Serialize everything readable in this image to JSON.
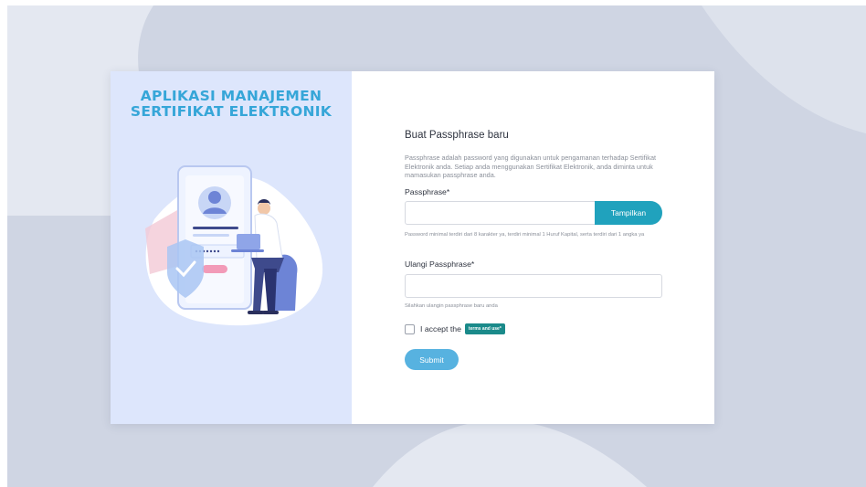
{
  "app": {
    "title_line1": "APLIKASI MANAJEMEN",
    "title_line2": "SERTIFIKAT ELEKTRONIK"
  },
  "form": {
    "heading": "Buat Passphrase baru",
    "description": "Passphrase adalah password yang digunakan untuk pengamanan terhadap Sertifikat Elektronik anda. Setiap anda menggunakan Sertifikat Elektronik, anda diminta untuk mamasukan passphrase anda.",
    "passphrase_label": "Passphrase*",
    "passphrase_value": "",
    "show_button_label": "Tampilkan",
    "passphrase_hint": "Password minimal terdiri dari 8 karakter ya, terdiri minimal 1 Huruf Kapital, serta terdiri dari 1 angka ya",
    "repeat_label": "Ulangi Passphrase*",
    "repeat_value": "",
    "repeat_hint": "Silahkan ulangin passphrase baru anda",
    "accept_text": "I accept the",
    "terms_label": "terms and use*",
    "submit_label": "Submit"
  },
  "colors": {
    "accent": "#20a2bd",
    "submit": "#57b2e0",
    "title": "#36a6d8",
    "left_panel": "#dde6fc",
    "backdrop": "#cfd5e3"
  },
  "icons": [
    "user-avatar-icon",
    "shield-check-icon",
    "laptop-icon"
  ]
}
